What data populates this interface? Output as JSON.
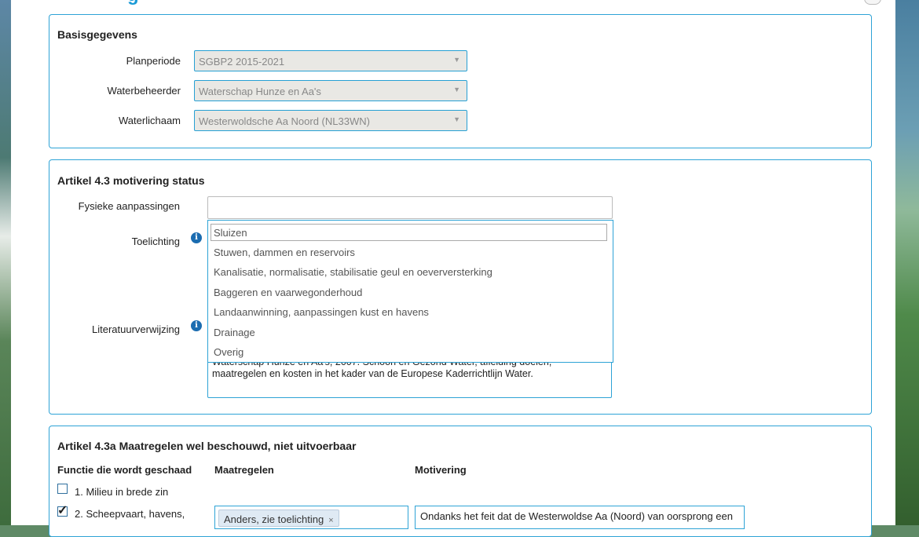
{
  "page": {
    "heading_fragment": "g"
  },
  "basis": {
    "title": "Basisgegevens",
    "planperiode_label": "Planperiode",
    "planperiode_value": "SGBP2 2015-2021",
    "waterbeheerder_label": "Waterbeheerder",
    "waterbeheerder_value": "Waterschap Hunze en Aa's",
    "waterlichaam_label": "Waterlichaam",
    "waterlichaam_value": "Westerwoldsche Aa Noord (NL33WN)"
  },
  "art43": {
    "title": "Artikel 4.3 motivering status",
    "fysieke_label": "Fysieke aanpassingen",
    "fysieke_value": "",
    "toelichting_label": "Toelichting",
    "literatuur_label": "Literatuurverwijzing",
    "literatuur_text_line1": "Waterschap Hunze en Aa's, 2007. Schoon en Gezond Water, afleiding doelen,",
    "literatuur_text_line2": "maatregelen en kosten in het kader van de Europese Kaderrichtlijn Water."
  },
  "dropdown": {
    "items": [
      "Sluizen",
      "Stuwen, dammen en reservoirs",
      "Kanalisatie, normalisatie, stabilisatie geul en oeverversterking",
      "Baggeren en vaarwegonderhoud",
      "Landaanwinning, aanpassingen kust en havens",
      "Drainage",
      "Overig"
    ]
  },
  "art43a": {
    "title": "Artikel 4.3a Maatregelen wel beschouwd, niet uitvoerbaar",
    "col_functie": "Functie die wordt geschaad",
    "col_maatregelen": "Maatregelen",
    "col_motivering": "Motivering",
    "rows": [
      {
        "label": "1. Milieu in brede zin",
        "checked": false
      },
      {
        "label": "2. Scheepvaart, havens,",
        "checked": true
      }
    ],
    "tag": "Anders, zie toelichting",
    "motivering_text": "Ondanks het feit dat de Westerwoldse Aa (Noord) van oorsprong een"
  },
  "icons": {
    "info": "info-icon",
    "dropdown_arrow": "chevron-down-icon",
    "remove_tag": "close-icon",
    "check": "checkmark-icon"
  }
}
